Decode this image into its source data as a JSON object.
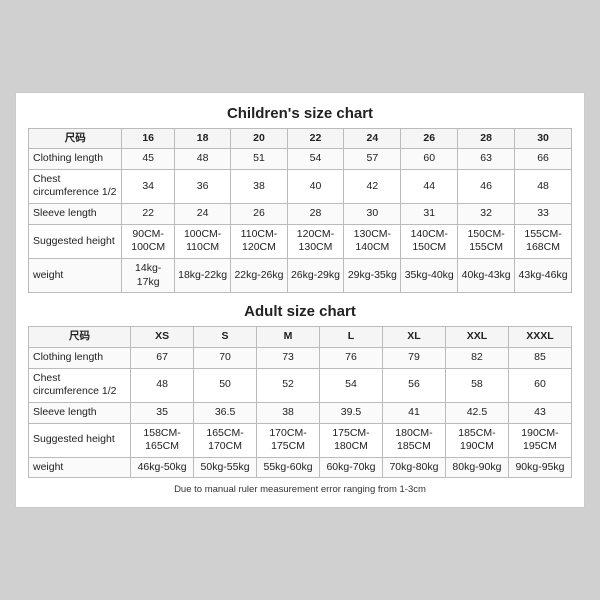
{
  "children_chart": {
    "title": "Children's size chart",
    "columns": [
      "尺码",
      "16",
      "18",
      "20",
      "22",
      "24",
      "26",
      "28",
      "30"
    ],
    "rows": [
      {
        "label": "Clothing length",
        "values": [
          "45",
          "48",
          "51",
          "54",
          "57",
          "60",
          "63",
          "66"
        ]
      },
      {
        "label": "Chest circumference 1/2",
        "values": [
          "34",
          "36",
          "38",
          "40",
          "42",
          "44",
          "46",
          "48"
        ]
      },
      {
        "label": "Sleeve length",
        "values": [
          "22",
          "24",
          "26",
          "28",
          "30",
          "31",
          "32",
          "33"
        ]
      },
      {
        "label": "Suggested height",
        "values": [
          "90CM-100CM",
          "100CM-110CM",
          "110CM-120CM",
          "120CM-130CM",
          "130CM-140CM",
          "140CM-150CM",
          "150CM-155CM",
          "155CM-168CM"
        ]
      },
      {
        "label": "weight",
        "values": [
          "14kg-17kg",
          "18kg-22kg",
          "22kg-26kg",
          "26kg-29kg",
          "29kg-35kg",
          "35kg-40kg",
          "40kg-43kg",
          "43kg-46kg"
        ]
      }
    ]
  },
  "adult_chart": {
    "title": "Adult size chart",
    "columns": [
      "尺码",
      "XS",
      "S",
      "M",
      "L",
      "XL",
      "XXL",
      "XXXL"
    ],
    "rows": [
      {
        "label": "Clothing length",
        "values": [
          "67",
          "70",
          "73",
          "76",
          "79",
          "82",
          "85"
        ]
      },
      {
        "label": "Chest circumference 1/2",
        "values": [
          "48",
          "50",
          "52",
          "54",
          "56",
          "58",
          "60"
        ]
      },
      {
        "label": "Sleeve length",
        "values": [
          "35",
          "36.5",
          "38",
          "39.5",
          "41",
          "42.5",
          "43"
        ]
      },
      {
        "label": "Suggested height",
        "values": [
          "158CM-165CM",
          "165CM-170CM",
          "170CM-175CM",
          "175CM-180CM",
          "180CM-185CM",
          "185CM-190CM",
          "190CM-195CM"
        ]
      },
      {
        "label": "weight",
        "values": [
          "46kg-50kg",
          "50kg-55kg",
          "55kg-60kg",
          "60kg-70kg",
          "70kg-80kg",
          "80kg-90kg",
          "90kg-95kg"
        ]
      }
    ]
  },
  "footnote": "Due to manual ruler measurement error ranging from 1-3cm"
}
